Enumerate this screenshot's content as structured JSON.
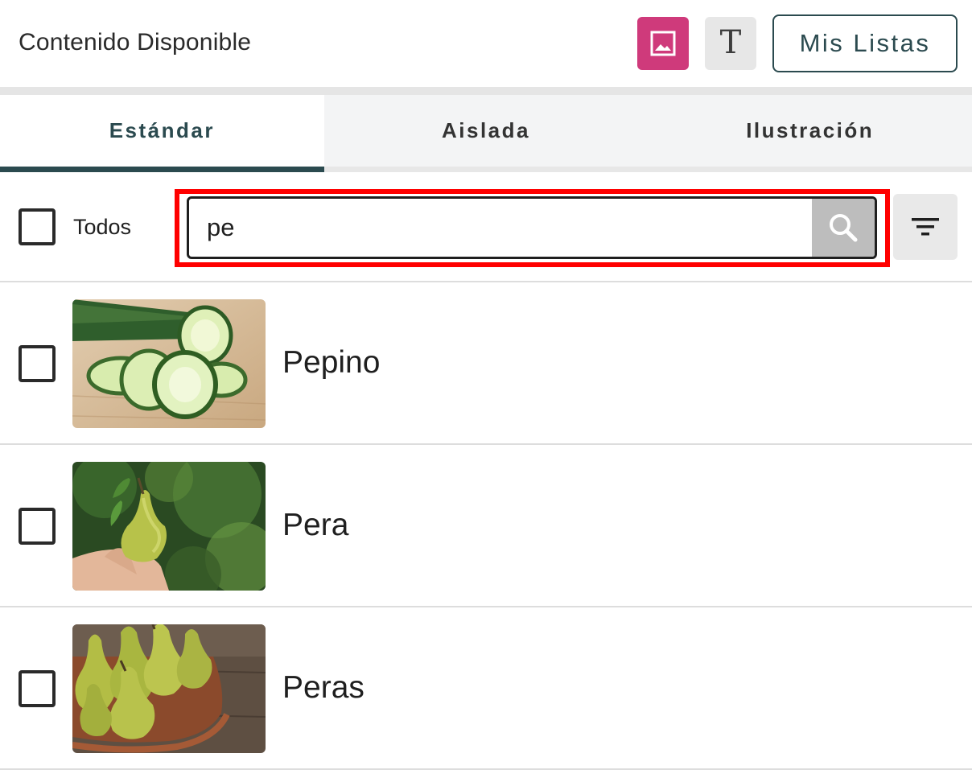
{
  "header": {
    "title": "Contenido Disponible",
    "mode_image_icon": "image-icon",
    "mode_text_glyph": "T",
    "my_lists_label": "Mis Listas"
  },
  "tabs": [
    {
      "label": "Estándar",
      "active": true
    },
    {
      "label": "Aislada",
      "active": false
    },
    {
      "label": "Ilustración",
      "active": false
    }
  ],
  "search": {
    "select_all_label": "Todos",
    "select_all_checked": false,
    "query": "pe",
    "search_icon": "search-icon",
    "filter_icon": "filter-icon"
  },
  "results": [
    {
      "label": "Pepino",
      "checked": false,
      "thumbnail": "cucumber-photo"
    },
    {
      "label": "Pera",
      "checked": false,
      "thumbnail": "pear-in-hand-photo"
    },
    {
      "label": "Peras",
      "checked": false,
      "thumbnail": "pears-in-bowl-photo"
    }
  ],
  "colors": {
    "accent_pink": "#cf3a7b",
    "brand_teal": "#2b4a4f",
    "highlight_red": "#ff0000",
    "search_button_gray": "#bdbdbd"
  }
}
